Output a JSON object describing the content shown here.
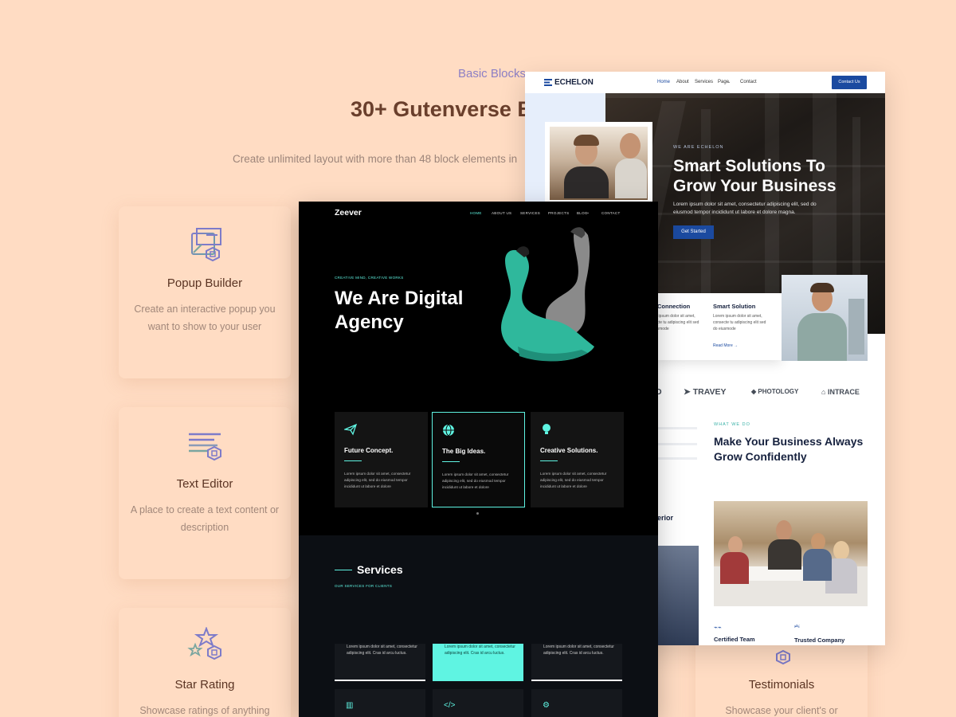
{
  "background": {
    "eyebrow": "Basic Blocks",
    "title": "30+ Gutenverse B",
    "subtitle": "Create unlimited layout with more than 48 block elements in",
    "cards": [
      {
        "title": "Popup Builder",
        "desc": "Create an interactive popup you want to show to your user",
        "icon": "popup-builder-icon"
      },
      {
        "title": "Text Editor",
        "desc": "A place to create a text content or description",
        "icon": "text-editor-icon"
      },
      {
        "title": "Star Rating",
        "desc": "Showcase ratings of anything",
        "icon": "star-rating-icon"
      },
      {
        "title": "Testimonials",
        "desc": "Showcase your client's or",
        "icon": "testimonials-icon"
      }
    ]
  },
  "echelon": {
    "logo": "ECHELON",
    "nav": [
      "Home",
      "About",
      "Services",
      "Page",
      "Contact"
    ],
    "cta": "Contact Us",
    "eyebrow": "WE ARE ECHELON",
    "headline": "Smart Solutions To Grow Your Business",
    "paragraph": "Lorem ipsum dolor sit amet, consectetur adipiscing elit, sed do eiusmod tempor incididunt ut labore et dolore magna.",
    "button": "Get Started",
    "cards": [
      {
        "title": "Connection",
        "desc": "Lorem ipsum dolor sit amet, consecte tu adipiscing elit sed do eiusmode",
        "link": "Read More"
      },
      {
        "title": "Smart Solution",
        "desc": "Lorem ipsum dolor sit amet, consecte tu adipiscing elit sed do eiusmode",
        "link": "Read More"
      }
    ],
    "logos": [
      "TRAVEY",
      "PHOTOLOGY",
      "INTRACE"
    ],
    "logo_fragment": "D",
    "what_we_do": "WHAT WE DO",
    "section_title": "Make Your Business Always Grow Confidently",
    "exterior_fragment": "erior",
    "stats": [
      {
        "label": "Certified Team"
      },
      {
        "label": "Trusted Company"
      }
    ]
  },
  "zeever": {
    "logo": "Zeever",
    "nav": [
      "HOME",
      "ABOUT US",
      "SERVICES",
      "PROJECTS",
      "BLOG",
      "CONTACT"
    ],
    "tagline": "CREATIVE MIND, CREATIVE WORKS",
    "headline_line1": "We Are Digital",
    "headline_line2": "Agency",
    "cards": [
      {
        "title": "Future Concept.",
        "desc": "Lorem ipsum dolor sit amet, consectetur adipiscing elit, sed do eiusmod tempor incididunt ut labore et dolore"
      },
      {
        "title": "The Big Ideas.",
        "desc": "Lorem ipsum dolor sit amet, consectetur adipiscing elit, sed do eiusmod tempor incididunt ut labore et dolore"
      },
      {
        "title": "Creative Solutions.",
        "desc": "Lorem ipsum dolor sit amet, consectetur adipiscing elit, sed do eiusmod tempor incididunt ut labore et dolore"
      }
    ],
    "services_title": "Services",
    "services_sub": "OUR SERVICES FOR CLIENTS",
    "service_text": "Lorem ipsum dolor sit amet, consectetur adipiscing elit. Cras id arcu luctus.",
    "accent": "#5ff4e2"
  }
}
